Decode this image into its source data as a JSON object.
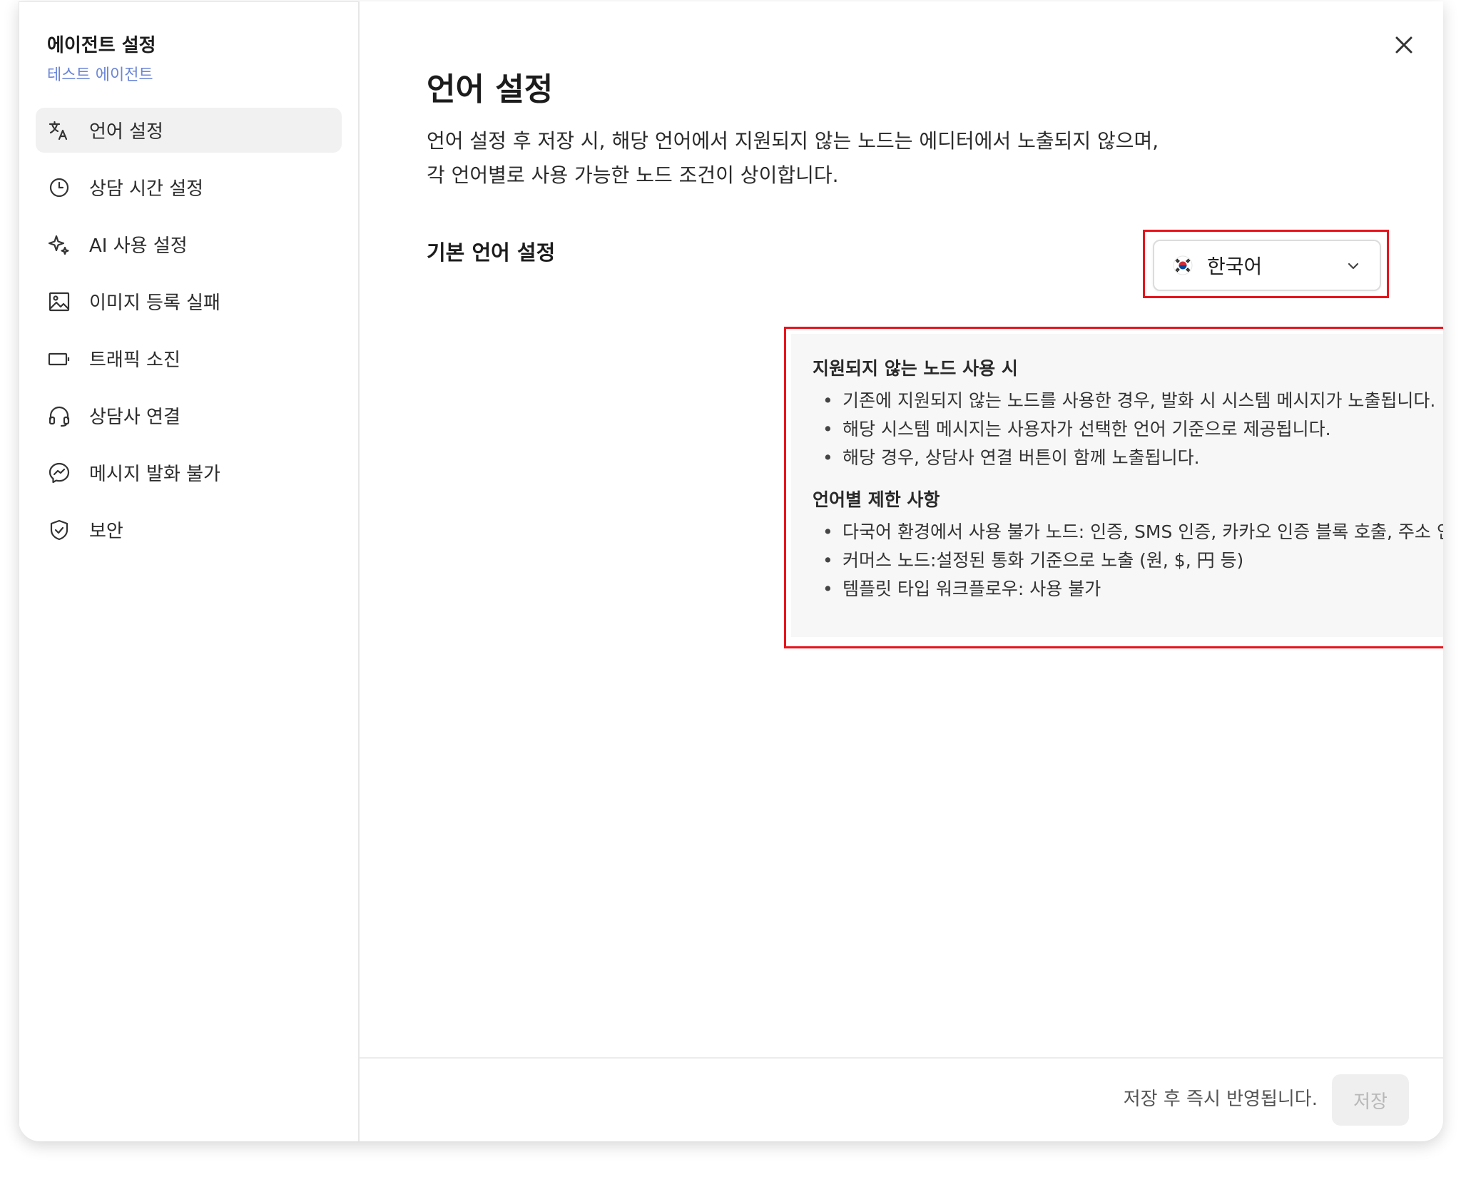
{
  "sidebar": {
    "title": "에이전트 설정",
    "subtitle": "테스트 에이전트",
    "items": [
      {
        "label": "언어 설정",
        "icon": "translate-icon",
        "active": true
      },
      {
        "label": "상담 시간 설정",
        "icon": "clock-icon",
        "active": false
      },
      {
        "label": "AI 사용 설정",
        "icon": "sparkle-icon",
        "active": false
      },
      {
        "label": "이미지 등록 실패",
        "icon": "image-icon",
        "active": false
      },
      {
        "label": "트래픽 소진",
        "icon": "battery-icon",
        "active": false
      },
      {
        "label": "상담사 연결",
        "icon": "headset-icon",
        "active": false
      },
      {
        "label": "메시지 발화 불가",
        "icon": "messenger-icon",
        "active": false
      },
      {
        "label": "보안",
        "icon": "shield-check-icon",
        "active": false
      }
    ]
  },
  "main": {
    "title": "언어 설정",
    "description_line1": "언어 설정 후 저장 시, 해당 언어에서 지원되지 않는 노드는 에디터에서 노출되지 않으며,",
    "description_line2": "각 언어별로 사용 가능한 노드 조건이 상이합니다.",
    "default_language": {
      "label": "기본 언어 설정",
      "selected": "한국어",
      "flag_icon": "korea-flag-icon"
    },
    "info": {
      "section1_title": "지원되지 않는 노드 사용 시",
      "section1_items": [
        "기존에 지원되지 않는 노드를 사용한 경우, 발화 시 시스템 메시지가 노출됩니다.",
        "해당 시스템 메시지는 사용자가 선택한 언어 기준으로 제공됩니다.",
        "해당 경우, 상담사 연결 버튼이 함께 노출됩니다."
      ],
      "section2_title": "언어별 제한 사항",
      "section2_items": [
        "다국어 환경에서 사용 불가 노드: 인증, SMS 인증, 카카오 인증 블록 호출, 주소 인증, 의도분석, 채널추가",
        "커머스 노드:설정된 통화 기준으로 노출 (원, $, 円 등)",
        "템플릿 타입 워크플로우: 사용 불가"
      ]
    }
  },
  "footer": {
    "note": "저장 후 즉시 반영됩니다.",
    "save_label": "저장"
  },
  "colors": {
    "highlight": "#e8141c",
    "subtitle_accent": "#6b86d6",
    "active_item_bg": "#f1f1f1"
  }
}
